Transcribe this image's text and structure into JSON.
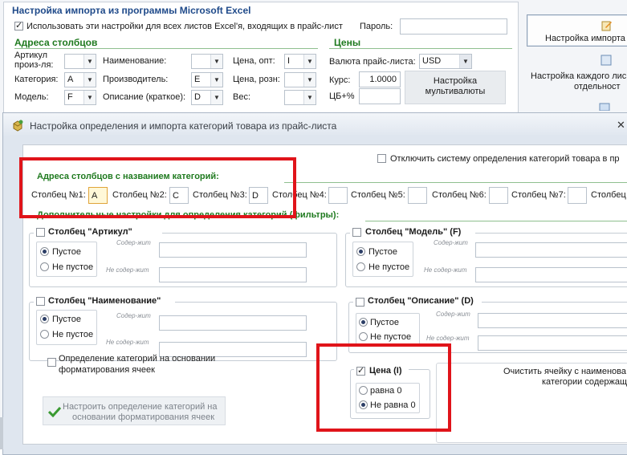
{
  "bg": {
    "title": "Настройка импорта из программы Microsoft Excel",
    "use_all_sheets_label": "Использовать эти настройки для всех листов Excel'я, входящих в прайс-лист",
    "password_label": "Пароль:",
    "columns_header": "Адреса столбцов",
    "prices_header": "Цены",
    "article_label": "Артикул произ-ля:",
    "article_value": "",
    "category_label": "Категория:",
    "category_value": "A",
    "model_label": "Модель:",
    "model_value": "F",
    "name_label": "Наименование:",
    "name_value": "",
    "producer_label": "Производитель:",
    "producer_value": "E",
    "desc_label": "Описание (краткое):",
    "desc_value": "D",
    "price_opt_label": "Цена, опт:",
    "price_opt_value": "I",
    "price_retail_label": "Цена, розн:",
    "price_retail_value": "",
    "weight_label": "Вес:",
    "weight_value": "",
    "currency_label": "Валюта прайс-листа:",
    "currency_value": "USD",
    "rate_label": "Курс:",
    "rate_value": "1.0000",
    "markup_label": "ЦБ+%",
    "markup_value": "",
    "multicurrency_btn": "Настройка мультивалюты",
    "import_settings_btn": "Настройка импорта",
    "each_sheet_btn_1": "Настройка каждого лис",
    "each_sheet_btn_2": "отдельност"
  },
  "dialog": {
    "title": "Настройка определения и импорта категорий товара из прайс-листа",
    "disable_label": "Отключить систему определения категорий товара в пр",
    "cat_columns_header": "Адреса столбцов с названием категорий:",
    "columns": [
      {
        "label": "Столбец №1:",
        "value": "A"
      },
      {
        "label": "Столбец №2:",
        "value": "C"
      },
      {
        "label": "Столбец №3:",
        "value": "D"
      },
      {
        "label": "Столбец №4:",
        "value": ""
      },
      {
        "label": "Столбец №5:",
        "value": ""
      },
      {
        "label": "Столбец №6:",
        "value": ""
      },
      {
        "label": "Столбец №7:",
        "value": ""
      },
      {
        "label": "Столбец",
        "value": ""
      }
    ],
    "filters_header": "Дополнительные настройки для определения категорий (фильтры):",
    "contains_hint": "Содер-жит",
    "not_contains_hint": "Не содер-жит",
    "empty_label": "Пустое",
    "not_empty_label": "Не пустое",
    "article_group": "Столбец \"Артикул\"",
    "model_group": "Столбец \"Модель\" (F)",
    "name_group": "Столбец \"Наименование\"",
    "desc_group": "Столбец \"Описание\" (D)",
    "price_group": "Цена (I)",
    "price_eq0": "равна 0",
    "price_ne0": "Не равна 0",
    "format_label_1": "Определение категорий на основании",
    "format_label_2": "форматирования ячеек",
    "format_btn_1": "Настроить определение категорий на",
    "format_btn_2": "основании форматирования ячеек",
    "clear_cell_1": "Очистить ячейку с наименова",
    "clear_cell_2": "категории содержащ"
  }
}
